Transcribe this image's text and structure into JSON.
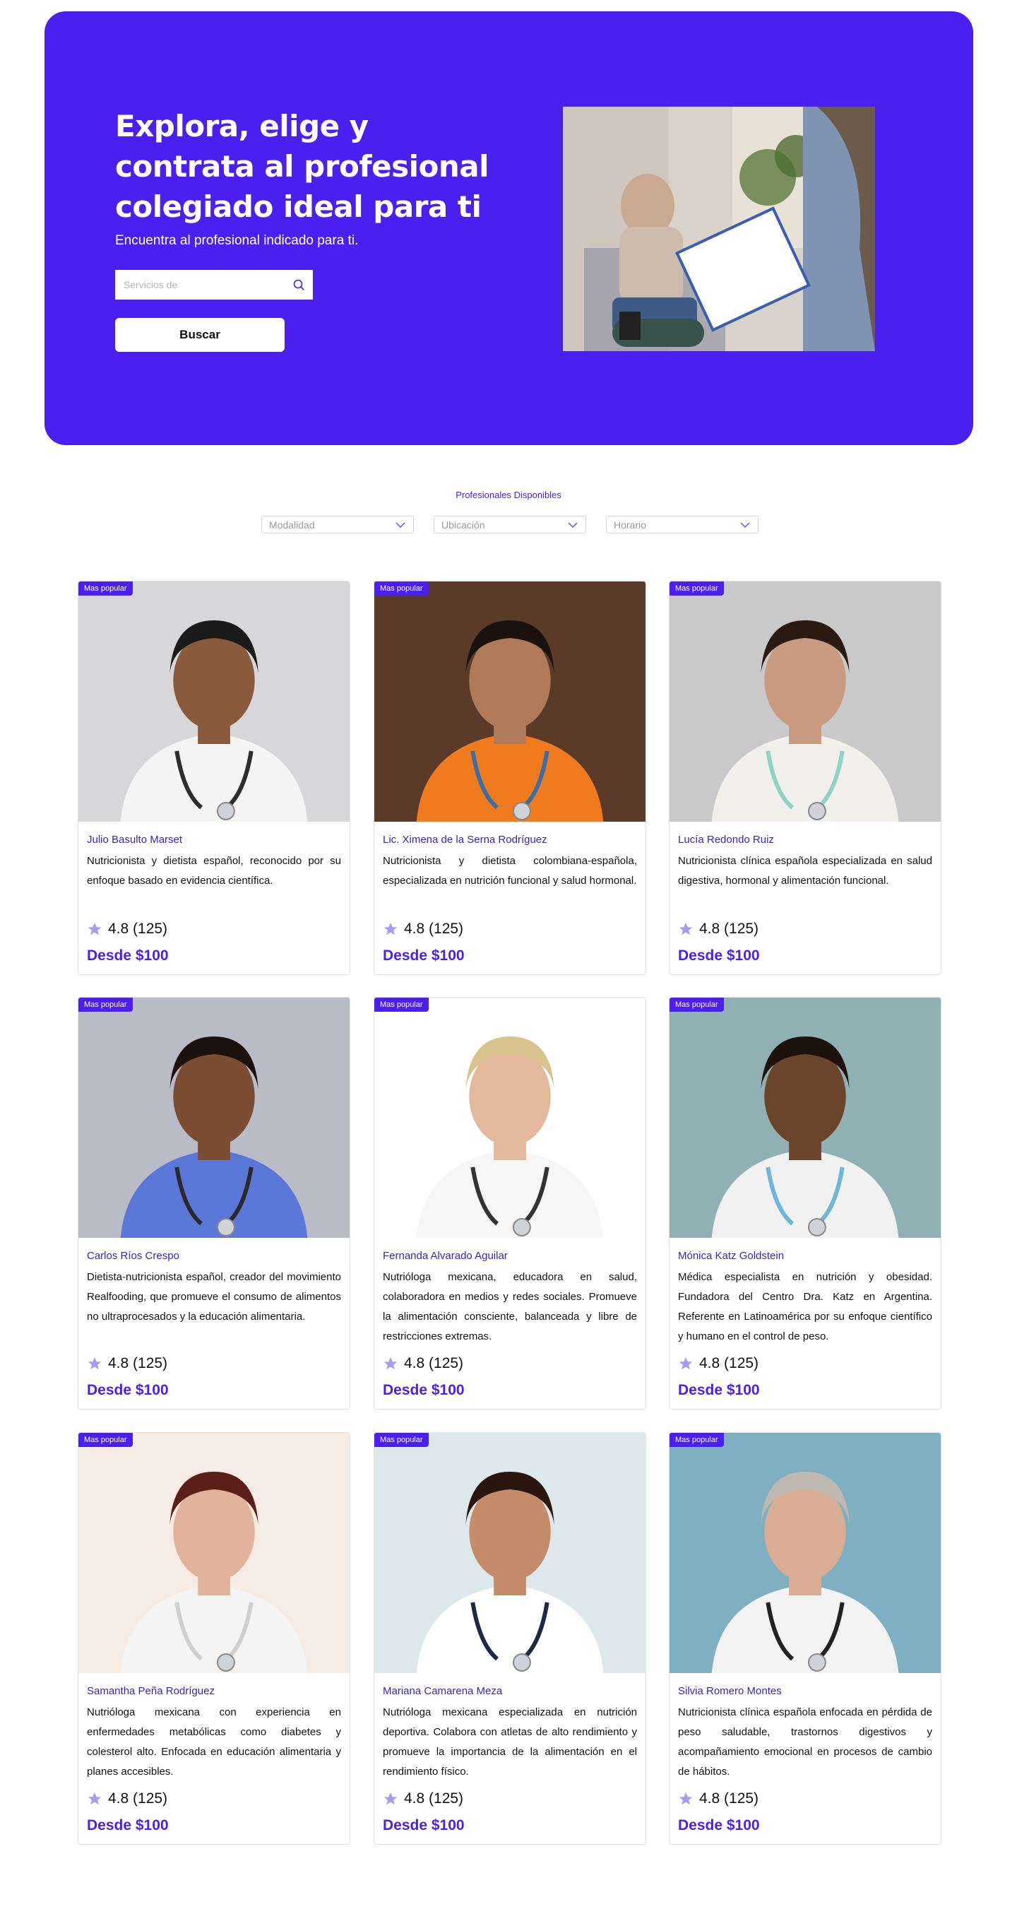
{
  "hero": {
    "title": "Explora, elige y contrata al profesional colegiado ideal para ti",
    "subtitle": "Encuentra al profesional indicado para ti.",
    "search_placeholder": "Servicios de",
    "search_button": "Buscar"
  },
  "filters": {
    "title": "Profesionales Disponibles",
    "modalidad": "Modalidad",
    "ubicacion": "Ubicación",
    "horario": "Horario"
  },
  "colors": {
    "accent": "#4a1ff0",
    "star": "#a99bf0"
  },
  "cards": [
    {
      "badge": "Mas popular",
      "name": "Julio Basulto Marset",
      "description": "Nutricionista y dietista español, reconocido por su enfoque basado en evidencia científica.",
      "rating": "4.8 (125)",
      "price": "Desde $100"
    },
    {
      "badge": "Mas popular",
      "name": "Lic. Ximena de la Serna Rodríguez",
      "description": "Nutricionista y dietista colombiana-española, especializada en nutrición funcional y salud hormonal.",
      "rating": "4.8 (125)",
      "price": "Desde $100"
    },
    {
      "badge": "Mas popular",
      "name": "Lucía Redondo Ruiz",
      "description": "Nutricionista clínica española especializada en salud digestiva, hormonal y alimentación funcional.",
      "rating": "4.8 (125)",
      "price": "Desde $100"
    },
    {
      "badge": "Mas popular",
      "name": "Carlos Ríos Crespo",
      "description": "Dietista-nutricionista español, creador del movimiento Realfooding, que promueve el consumo de alimentos no ultraprocesados y la educación alimentaria.",
      "rating": "4.8 (125)",
      "price": "Desde $100"
    },
    {
      "badge": "Mas popular",
      "name": "Fernanda Alvarado Aguilar",
      "description": "Nutrióloga mexicana, educadora en salud, colaboradora en medios y redes sociales. Promueve la alimentación consciente, balanceada y libre de restricciones extremas.",
      "rating": "4.8 (125)",
      "price": "Desde $100"
    },
    {
      "badge": "Mas popular",
      "name": "Mónica Katz Goldstein",
      "description": "Médica especialista en nutrición y obesidad. Fundadora del Centro Dra. Katz en Argentina. Referente en Latinoamérica por su enfoque científico y humano en el control de peso.",
      "rating": "4.8 (125)",
      "price": "Desde $100"
    },
    {
      "badge": "Mas popular",
      "name": "Samantha Peña Rodríguez",
      "description": "Nutrióloga mexicana con experiencia en enfermedades metabólicas como diabetes y colesterol alto. Enfocada en educación alimentaria y planes accesibles.",
      "rating": "4.8 (125)",
      "price": "Desde $100"
    },
    {
      "badge": "Mas popular",
      "name": "Mariana Camarena Meza",
      "description": "Nutrióloga mexicana especializada en nutrición deportiva. Colabora con atletas de alto rendimiento y promueve la importancia de la alimentación en el rendimiento físico.",
      "rating": "4.8 (125)",
      "price": "Desde $100"
    },
    {
      "badge": "Mas popular",
      "name": "Silvia Romero Montes",
      "description": "Nutricionista clínica española enfocada en pérdida de peso saludable, trastornos digestivos y acompañamiento emocional en procesos de cambio de hábitos.",
      "rating": "4.8 (125)",
      "price": "Desde $100"
    }
  ]
}
